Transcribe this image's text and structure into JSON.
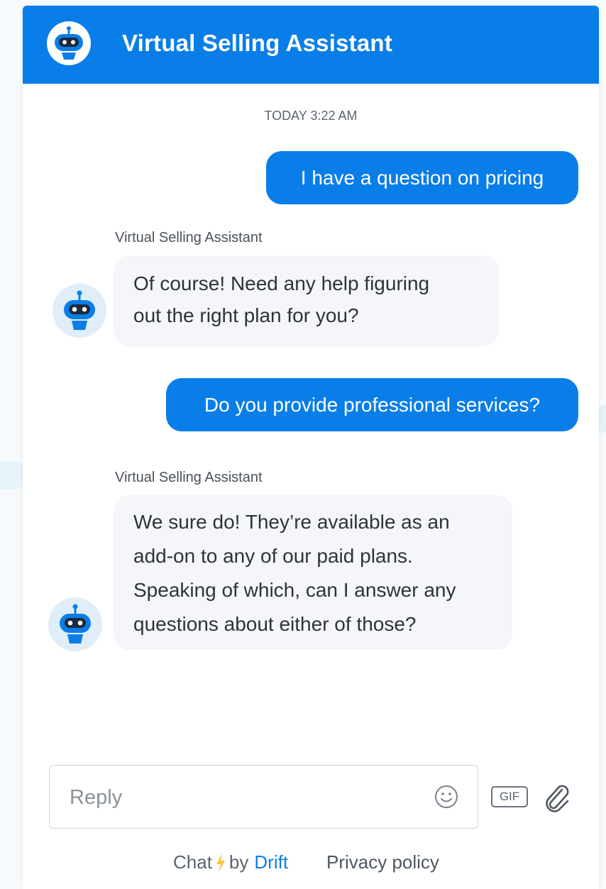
{
  "colors": {
    "brand": "#0a7ee8",
    "bot_bubble": "#f4f6f9",
    "avatar_bg": "#dfeef9"
  },
  "header": {
    "title": "Virtual Selling Assistant",
    "avatar_icon": "robot-icon"
  },
  "conversation": {
    "timestamp": "TODAY 3:22 AM",
    "messages": [
      {
        "from": "user",
        "text": "I have a question on pricing"
      },
      {
        "from": "bot",
        "sender": "Virtual Selling Assistant",
        "lines": [
          "Of course! Need any help figuring",
          "out the right plan for you?"
        ]
      },
      {
        "from": "user",
        "text": "Do you provide professional services?"
      },
      {
        "from": "bot",
        "sender": "Virtual Selling Assistant",
        "lines": [
          "We sure do! They’re available as an",
          "add-on to any of our paid plans.",
          "Speaking of which, can I answer any",
          "questions about either of those?"
        ]
      }
    ]
  },
  "composer": {
    "placeholder": "Reply",
    "emoji_icon": "smiley-icon",
    "gif_label": "GIF",
    "attach_icon": "paperclip-icon"
  },
  "footer": {
    "chat_label": "Chat",
    "bolt_icon": "lightning-bolt-icon",
    "by_label": "by",
    "drift_label": "Drift",
    "privacy_label": "Privacy policy"
  }
}
